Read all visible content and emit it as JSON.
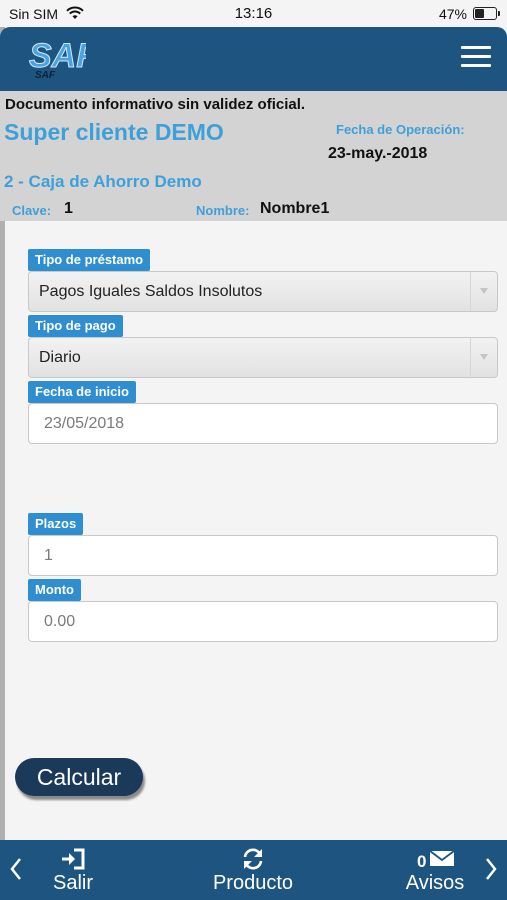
{
  "status_bar": {
    "carrier": "Sin SIM",
    "time": "13:16",
    "battery_percent": "47%"
  },
  "header": {
    "logo_text": "SAF",
    "logo_sub": "SAF"
  },
  "info": {
    "notice": "Documento informativo sin validez oficial.",
    "client_name": "Super cliente DEMO",
    "fecha_label": "Fecha de Operación:",
    "fecha_value": "23-may.-2018",
    "account": "2 - Caja de Ahorro Demo",
    "clave_label": "Clave:",
    "clave_value": "1",
    "nombre_label": "Nombre:",
    "nombre_value": "Nombre1"
  },
  "form": {
    "tipo_prestamo": {
      "label": "Tipo de préstamo",
      "value": "Pagos Iguales Saldos Insolutos"
    },
    "tipo_pago": {
      "label": "Tipo de pago",
      "value": "Diario"
    },
    "fecha_inicio": {
      "label": "Fecha de inicio",
      "value": "23/05/2018"
    },
    "plazos": {
      "label": "Plazos",
      "placeholder": "1"
    },
    "monto": {
      "label": "Monto",
      "placeholder": "0.00"
    },
    "calcular_label": "Calcular"
  },
  "bottom_nav": {
    "salir": "Salir",
    "producto": "Producto",
    "avisos": "Avisos",
    "avisos_count": "0"
  }
}
